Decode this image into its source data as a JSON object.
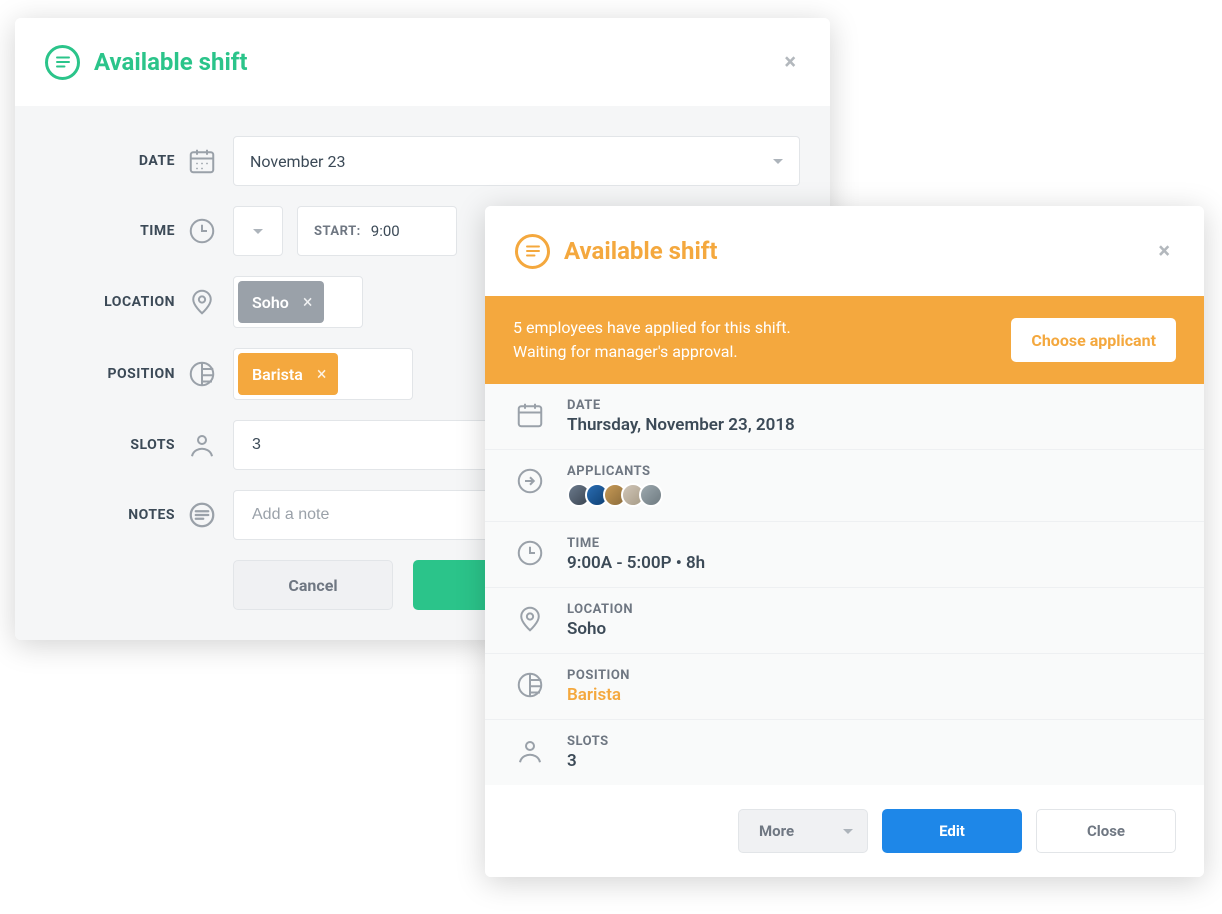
{
  "modal1": {
    "title": "Available shift",
    "fields": {
      "date": {
        "label": "DATE",
        "value": "November 23"
      },
      "time": {
        "label": "TIME",
        "start_label": "START:",
        "start_value": "9:00"
      },
      "location": {
        "label": "LOCATION",
        "tag": "Soho"
      },
      "position": {
        "label": "POSITION",
        "tag": "Barista"
      },
      "slots": {
        "label": "SLOTS",
        "value": "3"
      },
      "notes": {
        "label": "NOTES",
        "placeholder": "Add a note"
      }
    },
    "actions": {
      "cancel": "Cancel"
    }
  },
  "modal2": {
    "title": "Available shift",
    "banner": {
      "line1": "5 employees have applied for this shift.",
      "line2": "Waiting for manager's approval.",
      "button": "Choose applicant"
    },
    "details": {
      "date": {
        "label": "DATE",
        "value": "Thursday, November 23, 2018"
      },
      "applicants": {
        "label": "APPLICANTS",
        "count": 5
      },
      "time": {
        "label": "TIME",
        "value": "9:00A - 5:00P • 8h"
      },
      "location": {
        "label": "LOCATION",
        "value": "Soho"
      },
      "position": {
        "label": "POSITION",
        "value": "Barista"
      },
      "slots": {
        "label": "SLOTS",
        "value": "3"
      }
    },
    "actions": {
      "more": "More",
      "edit": "Edit",
      "close": "Close"
    }
  },
  "colors": {
    "green": "#2bc48a",
    "orange": "#f4a83e",
    "blue": "#1e87e8"
  }
}
